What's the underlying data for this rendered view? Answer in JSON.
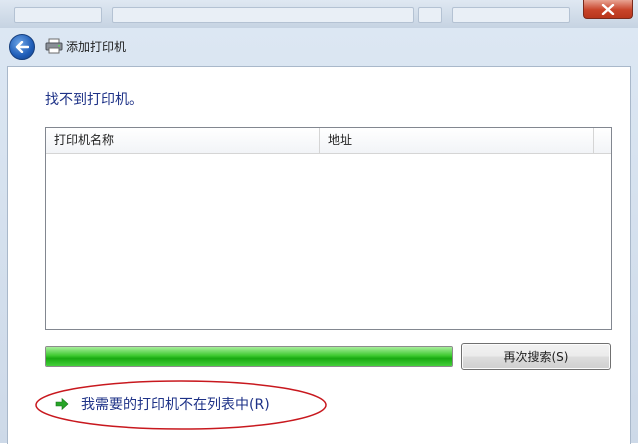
{
  "window": {
    "close_icon": "close-icon"
  },
  "dialog": {
    "title": "添加打印机",
    "back_icon": "back-arrow-icon",
    "printer_icon": "printer-icon"
  },
  "main": {
    "heading": "找不到打印机。",
    "list": {
      "columns": [
        "打印机名称",
        "地址"
      ],
      "rows": []
    },
    "progress": {
      "value": 1.0,
      "color": "#1fb31a"
    },
    "search_button_label": "再次搜索(S)",
    "not_listed_link": "我需要的打印机不在列表中(R)",
    "link_icon": "green-arrow-icon"
  },
  "colors": {
    "heading": "#1e3287",
    "link": "#1e3287",
    "annotation": "#c8181e"
  }
}
